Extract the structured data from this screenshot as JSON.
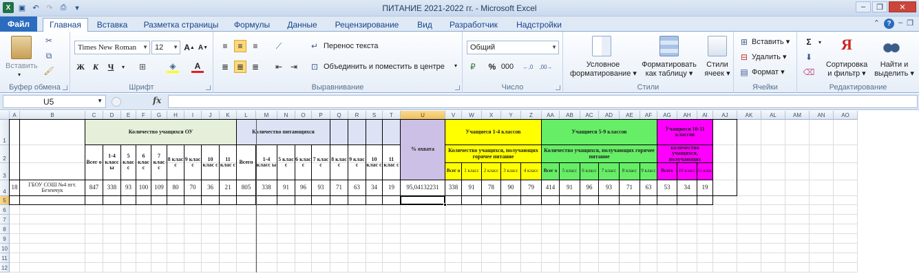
{
  "window": {
    "title": "ПИТАНИЕ  2021-2022 гг.  -  Microsoft Excel"
  },
  "tabs": [
    "Файл",
    "Главная",
    "Вставка",
    "Разметка страницы",
    "Формулы",
    "Данные",
    "Рецензирование",
    "Вид",
    "Разработчик",
    "Надстройки"
  ],
  "ribbon": {
    "clipboard": {
      "label": "Буфер обмена",
      "paste": "Вставить"
    },
    "font": {
      "label": "Шрифт",
      "name": "Times New Roman",
      "size": "12",
      "bold": "Ж",
      "italic": "К",
      "underline": "Ч"
    },
    "alignment": {
      "label": "Выравнивание",
      "wrap": "Перенос текста",
      "merge": "Объединить и поместить в центре"
    },
    "number": {
      "label": "Число",
      "format": "Общий",
      "percent": "%",
      "thousands": "000"
    },
    "styles": {
      "label": "Стили",
      "conditional": [
        "Условное",
        "форматирование"
      ],
      "table": [
        "Форматировать",
        "как таблицу"
      ],
      "cell_styles": [
        "Стили",
        "ячеек"
      ]
    },
    "cells": {
      "label": "Ячейки",
      "insert": "Вставить",
      "delete": "Удалить",
      "format": "Формат"
    },
    "editing": {
      "label": "Редактирование",
      "sort": [
        "Сортировка",
        "и фильтр"
      ],
      "find": [
        "Найти и",
        "выделить"
      ]
    }
  },
  "formula_bar": {
    "name_box": "U5",
    "fx": "fx",
    "value": ""
  },
  "columns": [
    "A",
    "B",
    "C",
    "D",
    "E",
    "F",
    "G",
    "H",
    "I",
    "J",
    "K",
    "L",
    "M",
    "N",
    "O",
    "P",
    "Q",
    "R",
    "S",
    "T",
    "U",
    "V",
    "W",
    "X",
    "Y",
    "Z",
    "AA",
    "AB",
    "AC",
    "AD",
    "AE",
    "AF",
    "AG",
    "AH",
    "AI",
    "AJ",
    "AK",
    "AL",
    "AM",
    "AN",
    "AO"
  ],
  "rows": [
    "1",
    "2",
    "3",
    "4",
    "5",
    "6",
    "7",
    "8",
    "9",
    "10",
    "11",
    "12"
  ],
  "selected_cell": {
    "col": "U",
    "row": "5"
  },
  "table": {
    "h_count_ou": "Количество учащихся ОУ",
    "h_count_fed": "Количество питающихся",
    "h_coverage": "% охвата",
    "h_1_4": "Учащиеся 1-4 классов",
    "h_1_4_sub": "Количество учащихся, получающих горячее питание",
    "h_5_9": "Учащиеся 5-9 классов",
    "h_5_9_sub": "Количество учащихся, получающих горячее питание",
    "h_10_11": "Учащиеся 10-11 классов",
    "h_10_11_sub": "количество учащихся, получающих",
    "vsego": "Всего",
    "vsego_short": "Всег о",
    "c14": "1-4 класс ы",
    "k5": "5 клас с",
    "k6": "6 клас с",
    "k7": "7 клас с",
    "k8": "8 клас с",
    "k9": "9 клас с",
    "k10": "10 клас с",
    "k11": "11 клас с",
    "g1": "1 класс",
    "g2": "2 класс",
    "g3": "3 класс",
    "g4": "4 класс",
    "g5": "5 класс",
    "g6": "6 класс",
    "g7": "7 класс",
    "g8": "8 класс",
    "g9": "9 класс",
    "g10": "10 класс",
    "g11": "11 клас",
    "row": {
      "num": "18",
      "school": "ГБОУ СОШ №4 пгт. Безенчук",
      "ou": [
        "847",
        "338",
        "93",
        "100",
        "109",
        "80",
        "70",
        "36",
        "21"
      ],
      "fed": [
        "805",
        "338",
        "91",
        "96",
        "93",
        "71",
        "63",
        "34",
        "19"
      ],
      "coverage": "95,04132231",
      "y14": [
        "338",
        "91",
        "78",
        "90",
        "79"
      ],
      "y59": [
        "414",
        "91",
        "96",
        "93",
        "71",
        "63"
      ],
      "y1011": [
        "53",
        "34",
        "19"
      ]
    }
  }
}
